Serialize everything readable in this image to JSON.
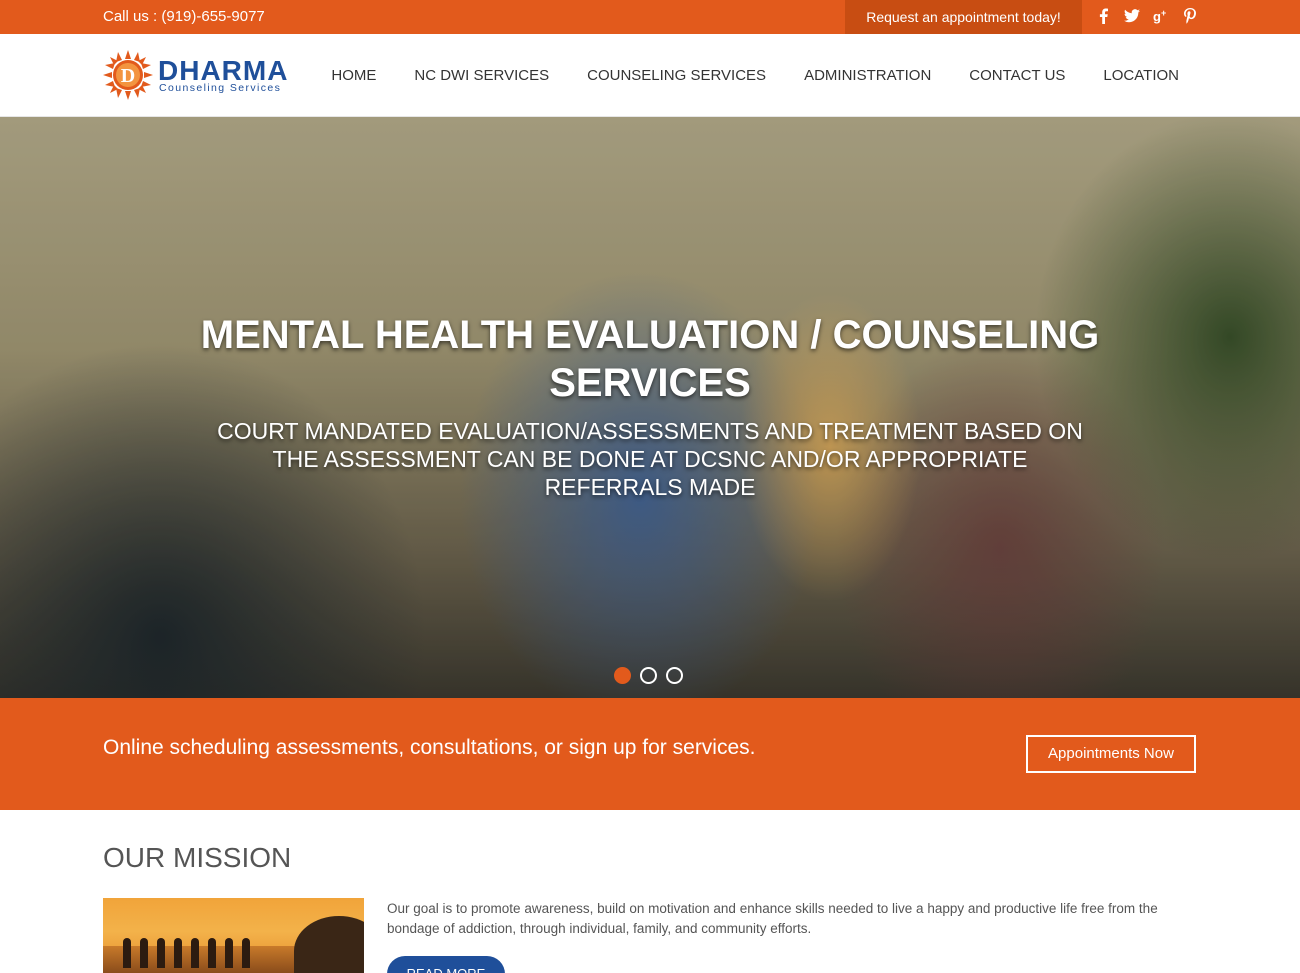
{
  "topbar": {
    "phone": "Call us : (919)-655-9077",
    "request_label": "Request an appointment today!",
    "social": [
      "facebook-icon",
      "twitter-icon",
      "google-plus-icon",
      "pinterest-icon"
    ]
  },
  "header": {
    "logo_brand": "DHARMA",
    "logo_sub": "Counseling Services",
    "nav": [
      "HOME",
      "NC DWI SERVICES",
      "COUNSELING SERVICES",
      "ADMINISTRATION",
      "CONTACT US",
      "LOCATION"
    ]
  },
  "hero": {
    "title": "MENTAL HEALTH EVALUATION / COUNSELING SERVICES",
    "subtitle": "COURT MANDATED EVALUATION/ASSESSMENTS  AND TREATMENT BASED ON THE ASSESSMENT CAN BE DONE AT DCSNC AND/OR APPROPRIATE REFERRALS MADE",
    "slide_count": 3,
    "active_slide": 1
  },
  "cta": {
    "text": "Online scheduling assessments, consultations, or sign up for services.",
    "button_label": "Appointments Now"
  },
  "mission": {
    "title": "OUR MISSION",
    "text": "Our goal is to promote awareness, build on motivation and enhance skills needed to live a happy and productive life free from the bondage of addiction, through individual, family, and community efforts.",
    "read_more": "READ MORE"
  },
  "colors": {
    "accent": "#e25a1c",
    "accent_dark": "#c84d12",
    "brand_blue": "#1f4f9a"
  }
}
